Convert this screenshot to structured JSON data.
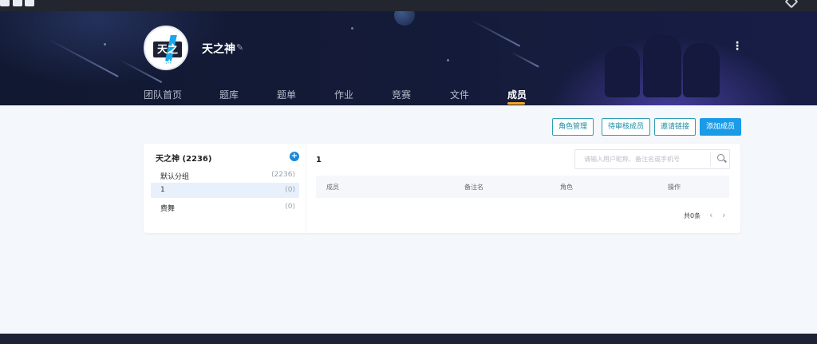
{
  "team": {
    "name": "天之神",
    "avatar_text": "天之神"
  },
  "tabs": [
    "团队首页",
    "题库",
    "题单",
    "作业",
    "竞赛",
    "文件",
    "成员"
  ],
  "active_tab": "成员",
  "actions": {
    "role_manage": "角色管理",
    "pending": "待审核成员",
    "invite": "邀请链接",
    "add": "添加成员"
  },
  "groups": {
    "title": "天之神 (2236)",
    "items": [
      {
        "name": "默认分组",
        "count": "(2236)"
      },
      {
        "name": "1",
        "count": "(0)"
      },
      {
        "name": "费舞",
        "count": "(0)"
      }
    ]
  },
  "members": {
    "title": "1",
    "search_placeholder": "请输入用户昵称、备注名或手机号",
    "columns": [
      "成员",
      "备注名",
      "角色",
      "操作"
    ],
    "total": "共0条"
  },
  "colors": {
    "accent": "#1a9be8",
    "tab_underline": "#f5a623",
    "banner": "#141b38"
  }
}
